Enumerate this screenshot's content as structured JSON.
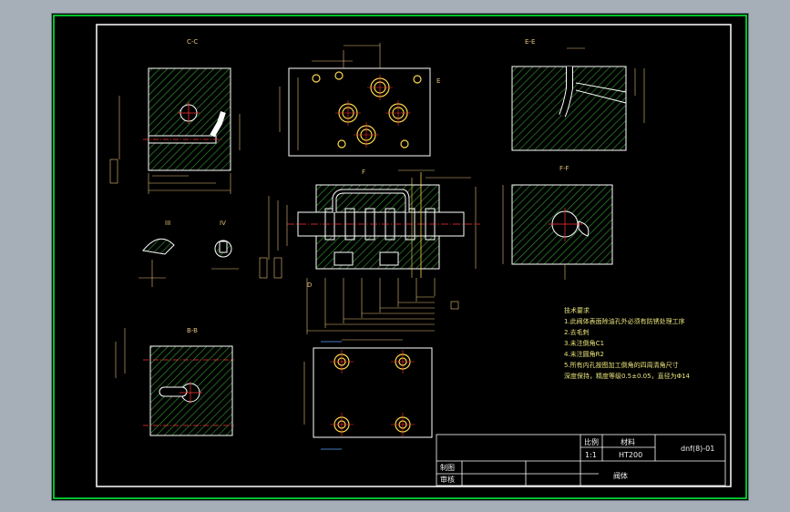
{
  "colors": {
    "background": "#000000",
    "frame": "#ffffff",
    "border": "#00ff3c",
    "hatch": "#2e8b2e",
    "dimension": "#e8c07a",
    "centerline": "#ff3333",
    "hole": "#ffd54a",
    "note_text": "#e8e27a"
  },
  "views": {
    "section_cc": "C-C",
    "section_ee": "E-E",
    "section_ff": "F-F",
    "section_bb": "B-B",
    "detail_iii": "III",
    "detail_iv": "IV"
  },
  "labels": {
    "e_marker": "E",
    "f_marker": "F",
    "d_marker": "D"
  },
  "tech_notes": {
    "title": "技术要求",
    "items": [
      "1.此阀体表面除油孔外必须有防锈处理工序",
      "2.去毛刺",
      "3.未注倒角C1",
      "4.未注圆角R2",
      "5.所有内孔按图加工倒角的四周清角尺寸",
      "深度保持，精度等级0.5±0.05，直径为Φ14"
    ]
  },
  "title_block": {
    "scale_label": "比例",
    "material_label": "材料",
    "scale_value": "1:1",
    "material_value": "HT200",
    "drawing_no": "dnf(8)-01",
    "drawn_by_label": "制图",
    "checked_by_label": "审核",
    "part_name": "阀体"
  }
}
